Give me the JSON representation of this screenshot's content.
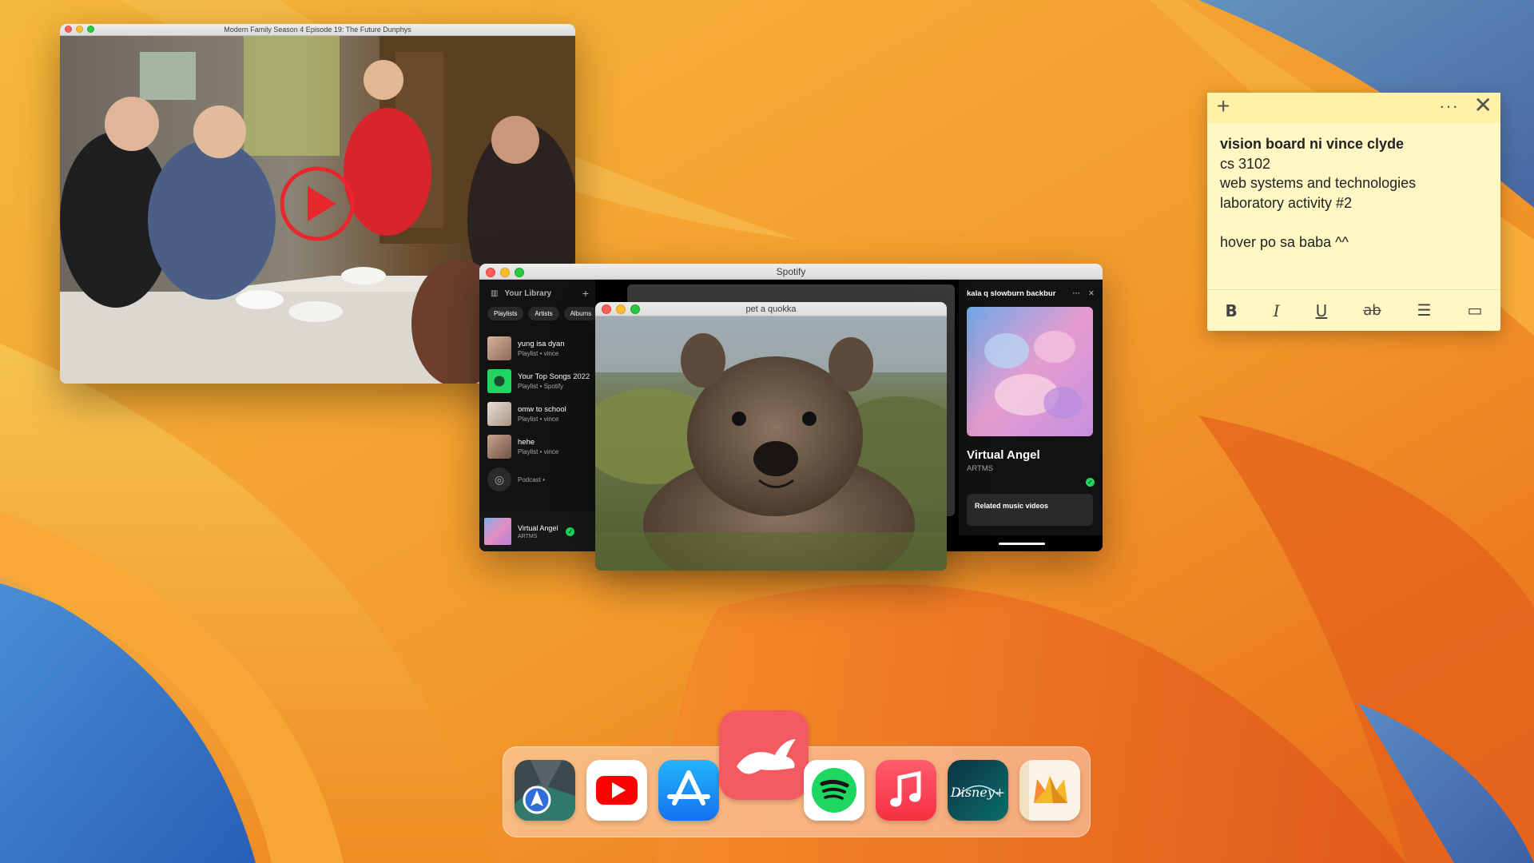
{
  "video_player": {
    "title": "Modern Family Season 4 Episode 19: The Future Dunphys",
    "controls": [
      "◂◂",
      "▸",
      "▸▸",
      "■",
      "☰"
    ]
  },
  "spotify": {
    "title": "Spotify",
    "library": {
      "heading": "Your Library",
      "add": "+",
      "chips": [
        "Playlists",
        "Artists",
        "Albums"
      ],
      "items": [
        {
          "title": "yung isa dyan",
          "subtitle": "Playlist • vince"
        },
        {
          "title": "Your Top Songs 2022",
          "subtitle": "Playlist • Spotify"
        },
        {
          "title": "omw to school",
          "subtitle": "Playlist • vince"
        },
        {
          "title": "hehe",
          "subtitle": "Playlist • vince"
        },
        {
          "title": "",
          "subtitle": "Podcast •"
        }
      ]
    },
    "now_playing": {
      "title": "Virtual Angel",
      "artist": "ARTMS"
    },
    "right_panel": {
      "title": "kala q slowburn backbur",
      "more": "···",
      "close": "✕",
      "song": "Virtual Angel",
      "artist": "ARTMS",
      "related": "Related music videos"
    }
  },
  "quokka": {
    "title": "pet a quokka"
  },
  "sticky_note": {
    "lines": [
      "vision board ni vince clyde",
      "cs 3102",
      "web systems and technologies",
      "laboratory activity #2",
      "hover po sa baba ^^"
    ],
    "toolbar": {
      "bold": "B",
      "italic": "I",
      "underline": "U",
      "strike": "ab",
      "list": "☰",
      "image": "▭"
    },
    "header": {
      "add": "+",
      "more": "···",
      "close": "✕"
    }
  },
  "dock": {
    "apps": [
      {
        "icon": "maps-icon"
      },
      {
        "icon": "youtube-icon"
      },
      {
        "icon": "app-store-icon"
      },
      {
        "icon": "rabbit-icon"
      },
      {
        "icon": "spotify-icon"
      },
      {
        "icon": "music-icon"
      },
      {
        "icon": "disney-plus-icon"
      },
      {
        "icon": "crown-icon"
      }
    ]
  },
  "colors": {
    "spotify_green": "#1ed760",
    "sticky_bg": "#fff8c4",
    "youtube_red": "#ff0000",
    "app_store_blue": "#1a8cf5",
    "music_red": "#fb3c4c",
    "rabbit_red": "#f35a62"
  }
}
